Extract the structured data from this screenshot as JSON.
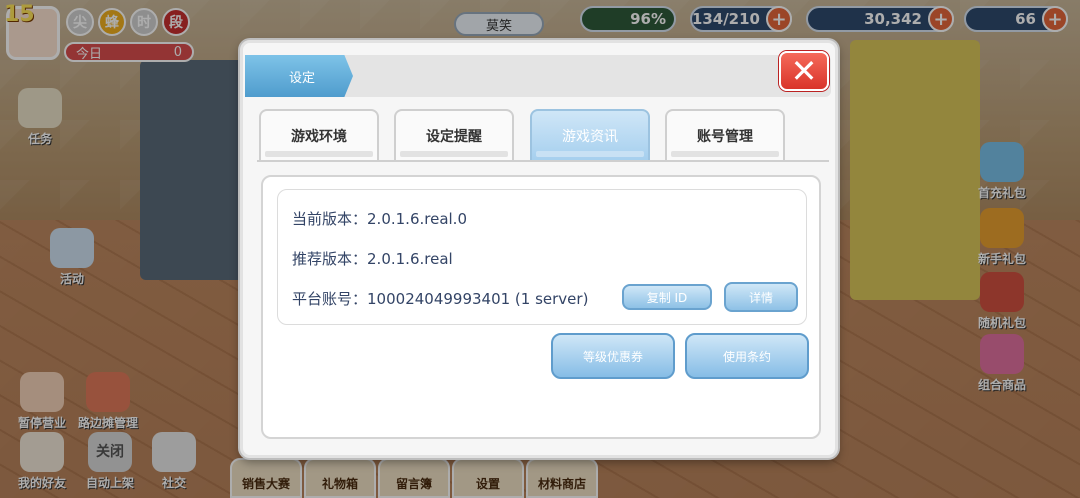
{
  "hud": {
    "level": "15",
    "badges": [
      "尖",
      "蜂",
      "时",
      "段"
    ],
    "today_label": "今日",
    "today_value": "0",
    "player_name": "莫笑",
    "satisfaction": "96%",
    "stamina": "134/210",
    "coins": "30,342",
    "gems": "66"
  },
  "left_menu": {
    "task": "任务",
    "event": "活动",
    "stop_business": "暂停营业",
    "roadside": "路边摊管理",
    "friends": "我的好友",
    "auto_shelf_close": "关闭",
    "auto_shelf": "自动上架",
    "social": "社交"
  },
  "right_menu": {
    "top_up_gift": "首充礼包",
    "newbie_gift": "新手礼包",
    "upgrade_gift": "随机礼包",
    "mall": "组合商品"
  },
  "dock": [
    "销售大赛",
    "礼物箱",
    "留言簿",
    "设置",
    "材料商店"
  ],
  "dialog": {
    "title": "设定",
    "tabs": [
      "游戏环境",
      "设定提醒",
      "游戏资讯",
      "账号管理"
    ],
    "active_tab": "游戏资讯",
    "current_version_label": "当前版本：",
    "current_version": "2.0.1.6.real.0",
    "recommended_version_label": "推荐版本：",
    "recommended_version": "2.0.1.6.real",
    "platform_account_label": "平台账号：",
    "platform_account": "100024049993401 (1 server)",
    "copy_id_button": "复制 ID",
    "details_button": "详情",
    "level_coupon_button": "等级优惠券",
    "terms_button": "使用条约"
  }
}
